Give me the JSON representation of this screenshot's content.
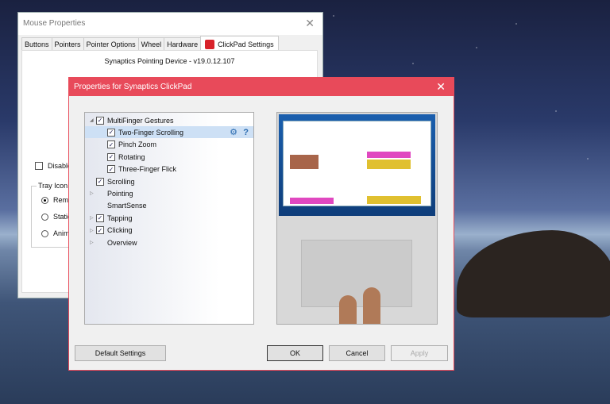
{
  "mouse_properties": {
    "title": "Mouse Properties",
    "tabs": [
      "Buttons",
      "Pointers",
      "Pointer Options",
      "Wheel",
      "Hardware",
      "ClickPad Settings"
    ],
    "version": "Synaptics Pointing Device - v19.0.12.107",
    "disable_label": "Disable",
    "tray_group": "Tray Icon",
    "radios": [
      {
        "label": "Remo",
        "selected": true
      },
      {
        "label": "Static",
        "selected": false
      },
      {
        "label": "Anima",
        "selected": false
      }
    ]
  },
  "clickpad": {
    "title": "Properties for Synaptics ClickPad",
    "accent": "#e84a5a",
    "tree": [
      {
        "label": "MultiFinger Gestures",
        "checked": true,
        "expander": "expanded",
        "level": 0
      },
      {
        "label": "Two-Finger Scrolling",
        "checked": true,
        "level": 1,
        "selected": true
      },
      {
        "label": "Pinch Zoom",
        "checked": true,
        "level": 1
      },
      {
        "label": "Rotating",
        "checked": true,
        "level": 1
      },
      {
        "label": "Three-Finger Flick",
        "checked": true,
        "level": 1
      },
      {
        "label": "Scrolling",
        "checked": true,
        "level": 0
      },
      {
        "label": "Pointing",
        "checked": null,
        "expander": "collapsed",
        "level": 0
      },
      {
        "label": "SmartSense",
        "checked": null,
        "level": 0
      },
      {
        "label": "Tapping",
        "checked": true,
        "expander": "collapsed",
        "level": 0
      },
      {
        "label": "Clicking",
        "checked": true,
        "expander": "collapsed",
        "level": 0
      },
      {
        "label": "Overview",
        "checked": null,
        "expander": "collapsed",
        "level": 0
      }
    ],
    "buttons": {
      "default": "Default Settings",
      "ok": "OK",
      "cancel": "Cancel",
      "apply": "Apply"
    },
    "help_glyph": "?"
  }
}
